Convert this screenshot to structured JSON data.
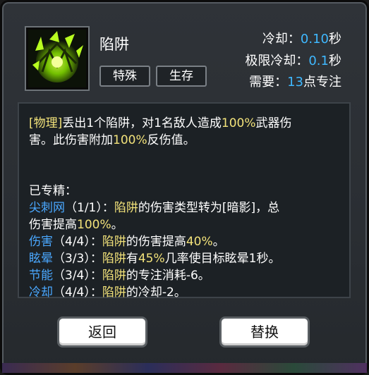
{
  "skill": {
    "name": "陷阱",
    "tags": [
      "特殊",
      "生存"
    ],
    "icon": "spiked-trap-icon",
    "icon_color": "#9be800"
  },
  "stats": [
    {
      "label": "冷却：",
      "value": "0.10",
      "unit": "秒"
    },
    {
      "label": "极限冷却：",
      "value": "0.1",
      "unit": "秒"
    },
    {
      "label": "需要：",
      "value": "13",
      "unit": "点专注"
    }
  ],
  "description": {
    "line1": {
      "p1": "[物理]",
      "p2": "丢出1个陷阱，对1名敌人造成",
      "p3": "100%",
      "p4": "武器伤"
    },
    "line2": "害。此伤害附加",
    "line2_val": "100%",
    "line2_end": "反伤值。"
  },
  "mastery": {
    "header": "已专精：",
    "spike": {
      "name": "尖刺网",
      "level": "（1/1）：",
      "target": "陷阱",
      "text": "的伤害类型转为[暗影]，总",
      "line2": "伤害提高",
      "val": "100%",
      "end": "。"
    },
    "damage": {
      "name": "伤害",
      "level": "（4/4）：",
      "target": "陷阱",
      "text": "的伤害提高",
      "val": "40%",
      "end": "。"
    },
    "stun": {
      "name": "眩晕",
      "level": "（3/3）：",
      "target": "陷阱",
      "text": "有",
      "val": "45%",
      "text2": "几率使目标眩晕1秒。"
    },
    "energy": {
      "name": "节能",
      "level": "（3/4）：",
      "target": "陷阱",
      "text": "的专注消耗-6。"
    },
    "cooldown": {
      "name": "冷却",
      "level": "（4/4）：",
      "target": "陷阱",
      "text": "的冷却-2。"
    }
  },
  "buttons": {
    "back": "返回",
    "swap": "替换"
  },
  "colors": {
    "highlight_blue": "#3fb8ff",
    "highlight_yellow": "#f2e27a",
    "panel": "#2c3035"
  }
}
